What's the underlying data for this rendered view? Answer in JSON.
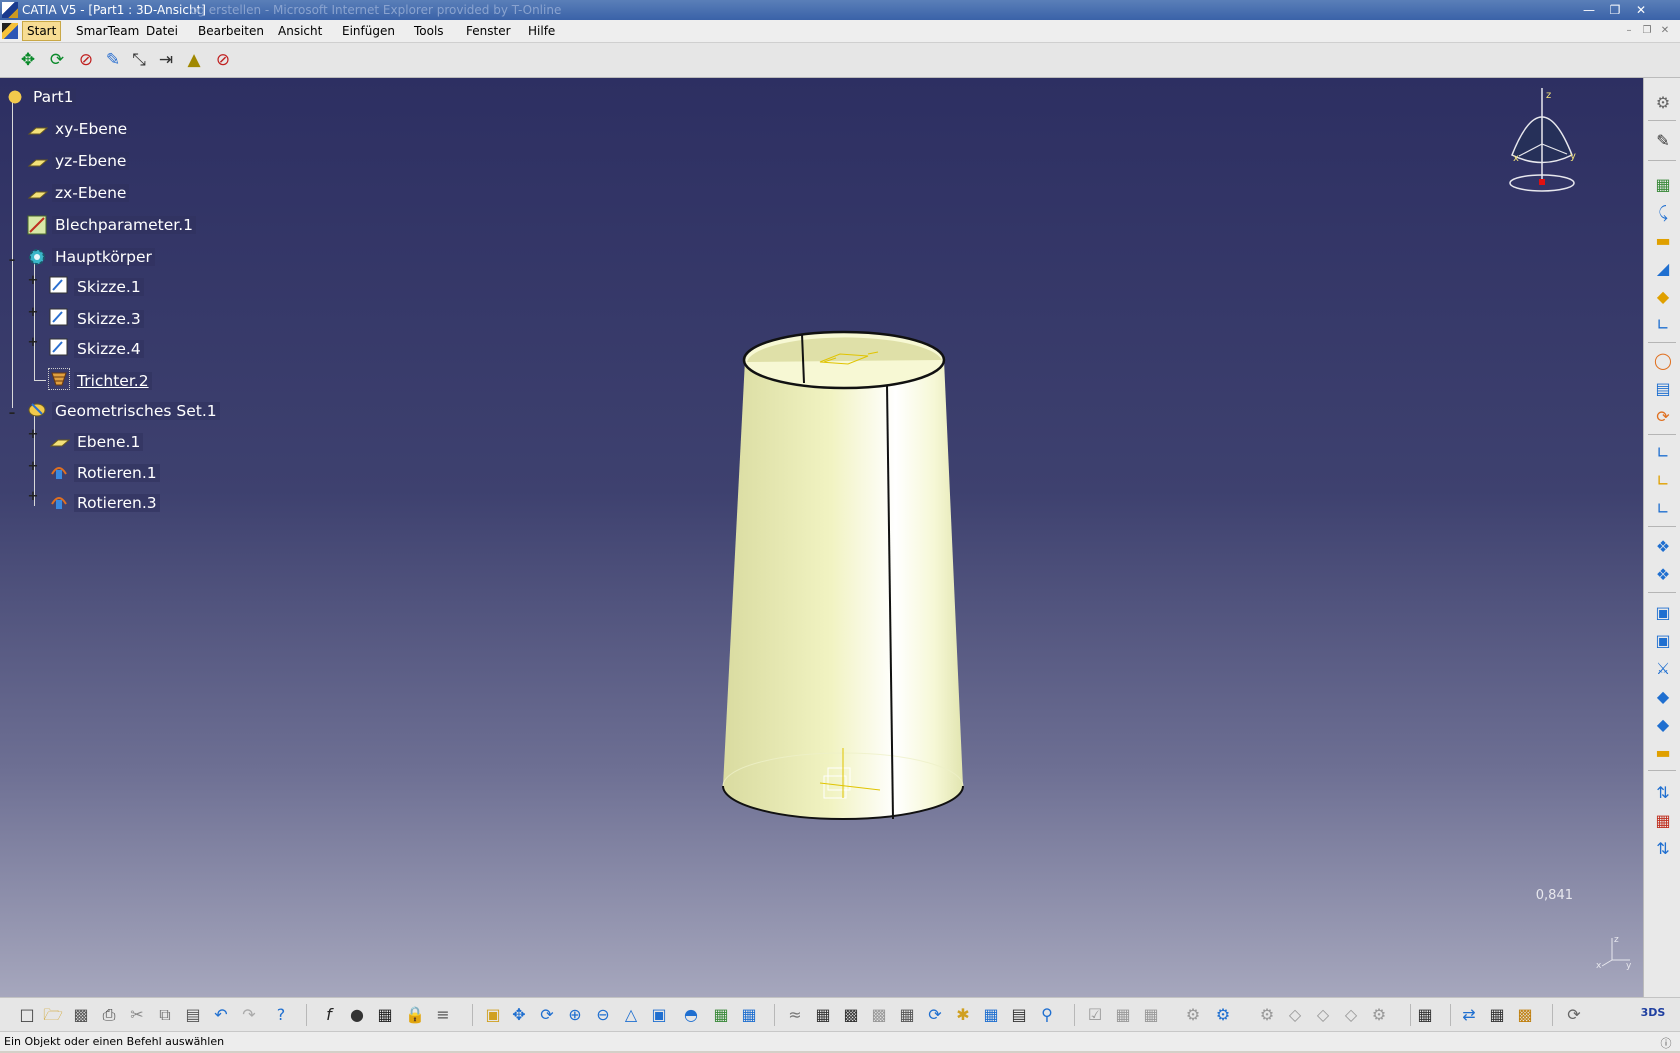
{
  "window": {
    "title": "CATIA V5 - [Part1 : 3D-Ansicht]",
    "background_title": "og erstellen - Microsoft Internet Explorer provided by T-Online"
  },
  "menu": {
    "items": [
      "Start",
      "SmarTeam",
      "Datei",
      "Bearbeiten",
      "Ansicht",
      "Einfügen",
      "Tools",
      "Fenster",
      "Hilfe"
    ]
  },
  "tree": {
    "root": "Part1",
    "nodes": [
      {
        "label": "xy-Ebene",
        "icon": "plane-icon"
      },
      {
        "label": "yz-Ebene",
        "icon": "plane-icon"
      },
      {
        "label": "zx-Ebene",
        "icon": "plane-icon"
      },
      {
        "label": "Blechparameter.1",
        "icon": "sheetmetal-parameters-icon"
      },
      {
        "label": "Hauptkörper",
        "icon": "body-gear-icon"
      },
      {
        "label": "Skizze.1",
        "icon": "sketch-icon"
      },
      {
        "label": "Skizze.3",
        "icon": "sketch-icon"
      },
      {
        "label": "Skizze.4",
        "icon": "sketch-icon"
      },
      {
        "label": "Trichter.2",
        "icon": "hopper-icon",
        "selected": true
      },
      {
        "label": "Geometrisches Set.1",
        "icon": "geometric-set-icon"
      },
      {
        "label": "Ebene.1",
        "icon": "plane-icon"
      },
      {
        "label": "Rotieren.1",
        "icon": "rotate-icon"
      },
      {
        "label": "Rotieren.3",
        "icon": "rotate-icon"
      }
    ]
  },
  "viewport": {
    "ratio": "0,841",
    "compass_axes": [
      "z",
      "x",
      "y"
    ]
  },
  "status": {
    "text": "Ein Objekt oder einen Befehl auswählen"
  },
  "colors": {
    "viewport_top": "#2d2f62",
    "viewport_bottom": "#a6a7bd",
    "part_fill": "#f4f4c2",
    "menu_active": "#f7dc93"
  }
}
